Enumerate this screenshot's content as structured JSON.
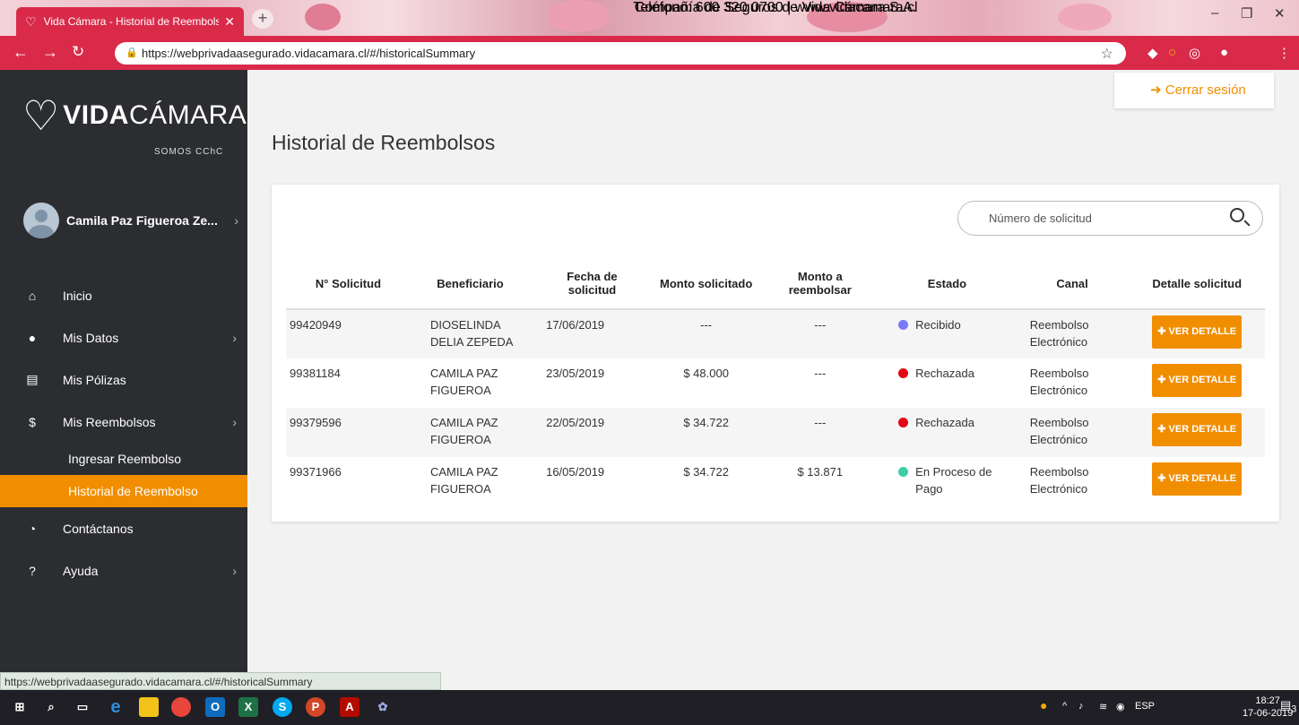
{
  "browser": {
    "tab_title": "Vida Cámara - Historial de Reembolsos",
    "url": "https://webprivadaasegurado.vidacamara.cl/#/historicalSummary",
    "status_url": "https://webprivadaasegurado.vidacamara.cl/#/historicalSummary"
  },
  "brand": {
    "bold": "VIDA",
    "light": "CÁMARA",
    "tagline": "SOMOS CChC"
  },
  "user": {
    "name": "Camila Paz Figueroa Ze..."
  },
  "menu": {
    "items": [
      {
        "label": "Inicio"
      },
      {
        "label": "Mis Datos"
      },
      {
        "label": "Mis Pólizas"
      },
      {
        "label": "Mis Reembolsos"
      },
      {
        "label": "Contáctanos"
      },
      {
        "label": "Ayuda"
      }
    ],
    "sub": [
      {
        "label": "Ingresar Reembolso"
      },
      {
        "label": "Historial de Reembolso"
      }
    ]
  },
  "header": {
    "logout": "Cerrar sesión",
    "title": "Historial de Reembolsos"
  },
  "search": {
    "placeholder": "Número de solicitud"
  },
  "table": {
    "headers": [
      "N° Solicitud",
      "Beneficiario",
      "Fecha de solicitud",
      "Monto solicitado",
      "Monto a reembolsar",
      "Estado",
      "Canal",
      "Detalle solicitud"
    ],
    "button_label": "VER DETALLE",
    "rows": [
      {
        "num": "99420949",
        "ben": "DIOSELINDA DELIA ZEPEDA",
        "date": "17/06/2019",
        "monto": "---",
        "reem": "---",
        "estado": "Recibido",
        "canal": "Reembolso Electrónico"
      },
      {
        "num": "99381184",
        "ben": "CAMILA PAZ FIGUEROA",
        "date": "23/05/2019",
        "monto": "$ 48.000",
        "reem": "---",
        "estado": "Rechazada",
        "canal": "Reembolso Electrónico"
      },
      {
        "num": "99379596",
        "ben": "CAMILA PAZ FIGUEROA",
        "date": "22/05/2019",
        "monto": "$ 34.722",
        "reem": "---",
        "estado": "Rechazada",
        "canal": "Reembolso Electrónico"
      },
      {
        "num": "99371966",
        "ben": "CAMILA PAZ FIGUEROA",
        "date": "16/05/2019",
        "monto": "$ 34.722",
        "reem": "$ 13.871",
        "estado": "En Proceso de Pago",
        "canal": "Reembolso Electrónico"
      }
    ]
  },
  "status_colors": {
    "recibido": "#7b79f7",
    "rechazada": "#e30613",
    "en_proceso": "#3ccfa6"
  },
  "accent": "#f18e00",
  "footer": {
    "company": "Compañía de Seguros de Vida Cámara S.A.",
    "contact": "Teléfono: 600 320 0700 | www.vidacamara.cl"
  },
  "taskbar": {
    "lang": "ESP",
    "time": "18:27",
    "date": "17-06-2019",
    "notifications": "3"
  }
}
